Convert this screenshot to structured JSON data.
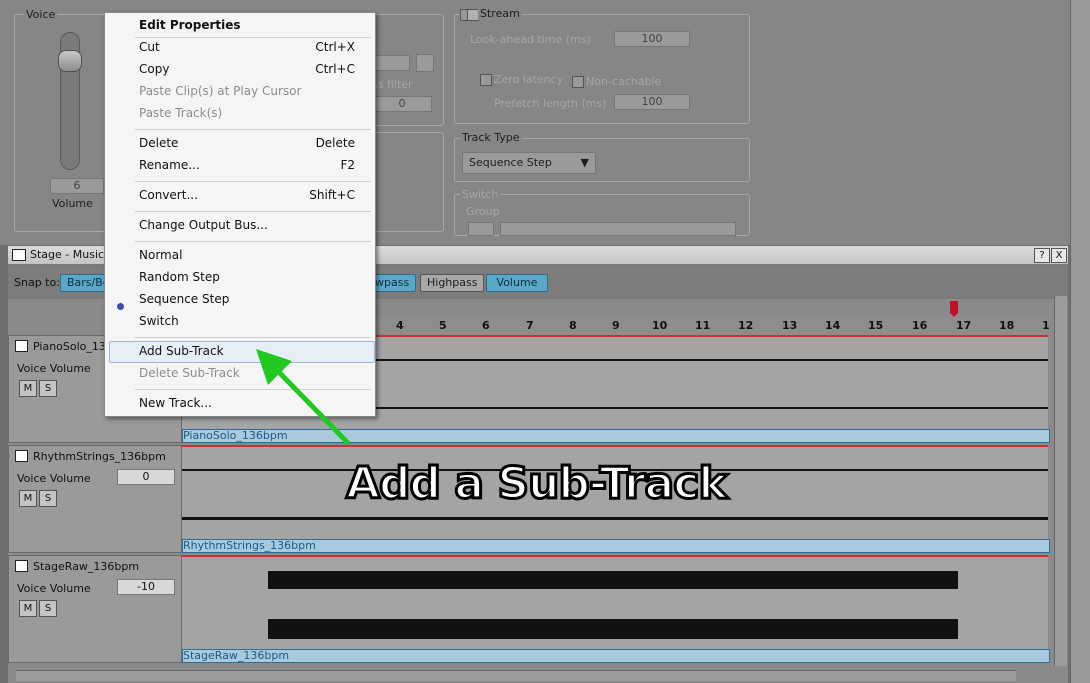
{
  "top_panel": {
    "voice_label": "Voice",
    "voice_value": "6",
    "volume_label": "Volume",
    "partial_filter_label": "ss filter",
    "partial_zero": "0",
    "stream_label": "Stream",
    "lookahead_label": "Look-ahead time (ms)",
    "lookahead_value": "100",
    "zero_latency_label": "Zero latency",
    "non_cachable_label": "Non-cachable",
    "prefetch_label": "Prefetch length (ms)",
    "prefetch_value": "100",
    "track_type_label": "Track Type",
    "track_type_value": "Sequence Step",
    "switch_label": "Switch",
    "group_label": "Group"
  },
  "stage": {
    "title": "Stage - Music S",
    "snap_to_label": "Snap to:",
    "snap_value": "Bars/Be",
    "filter_buttons": [
      {
        "label": "wpass",
        "active": true
      },
      {
        "label": "Highpass",
        "active": false
      },
      {
        "label": "Volume",
        "active": true
      }
    ],
    "help_btn": "?",
    "close_btn": "X",
    "ruler": [
      "4",
      "5",
      "6",
      "7",
      "8",
      "9",
      "10",
      "11",
      "12",
      "13",
      "14",
      "15",
      "16",
      "17",
      "18",
      "1"
    ]
  },
  "tracks": [
    {
      "name": "PianoSolo_136",
      "param_label": "Voice Volume",
      "param_value": "",
      "mute": "M",
      "solo": "S",
      "clip": "PianoSolo_136bpm"
    },
    {
      "name": "RhythmStrings_136bpm",
      "param_label": "Voice Volume",
      "param_value": "0",
      "mute": "M",
      "solo": "S",
      "clip": "RhythmStrings_136bpm"
    },
    {
      "name": "StageRaw_136bpm",
      "param_label": "Voice Volume",
      "param_value": "-10",
      "mute": "M",
      "solo": "S",
      "clip": "StageRaw_136bpm"
    }
  ],
  "context_menu": {
    "items": [
      {
        "label": "Edit Properties",
        "shortcut": "",
        "disabled": false,
        "bold": true
      },
      {
        "label": "Cut",
        "shortcut": "Ctrl+X",
        "disabled": false
      },
      {
        "label": "Copy",
        "shortcut": "Ctrl+C",
        "disabled": false
      },
      {
        "label": "Paste Clip(s) at Play Cursor",
        "shortcut": "",
        "disabled": true
      },
      {
        "label": "Paste Track(s)",
        "shortcut": "",
        "disabled": true
      },
      {
        "label": "Delete",
        "shortcut": "Delete",
        "disabled": false
      },
      {
        "label": "Rename...",
        "shortcut": "F2",
        "disabled": false
      },
      {
        "label": "Convert...",
        "shortcut": "Shift+C",
        "disabled": false
      },
      {
        "label": "Change Output Bus...",
        "shortcut": "",
        "disabled": false
      },
      {
        "label": "Normal",
        "shortcut": "",
        "disabled": false
      },
      {
        "label": "Random Step",
        "shortcut": "",
        "disabled": false
      },
      {
        "label": "Sequence Step",
        "shortcut": "",
        "disabled": false,
        "checked": true
      },
      {
        "label": "Switch",
        "shortcut": "",
        "disabled": false
      },
      {
        "label": "Add Sub-Track",
        "shortcut": "",
        "disabled": false,
        "highlighted": true
      },
      {
        "label": "Delete Sub-Track",
        "shortcut": "",
        "disabled": true
      },
      {
        "label": "New Track...",
        "shortcut": "",
        "disabled": false
      }
    ]
  },
  "annotation": {
    "text": "Add a Sub-Track",
    "arrow_color": "#22c822"
  },
  "colors": {
    "accent": "#5aa8c8",
    "playhead": "#c0102a",
    "lane_top": "#d03030",
    "clip_text": "#1d5a8a"
  }
}
